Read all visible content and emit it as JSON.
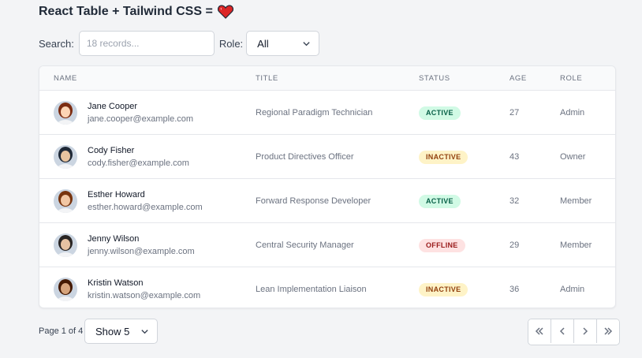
{
  "header": {
    "title": "React Table + Tailwind CSS =",
    "heart_icon": "heart-icon"
  },
  "filters": {
    "search_label": "Search:",
    "search_placeholder": "18 records...",
    "role_label": "Role:",
    "role_value": "All"
  },
  "table": {
    "columns": [
      "NAME",
      "TITLE",
      "STATUS",
      "AGE",
      "ROLE"
    ],
    "rows": [
      {
        "name": "Jane Cooper",
        "email": "jane.cooper@example.com",
        "title": "Regional Paradigm Technician",
        "status": "ACTIVE",
        "age": "27",
        "role": "Admin"
      },
      {
        "name": "Cody Fisher",
        "email": "cody.fisher@example.com",
        "title": "Product Directives Officer",
        "status": "INACTIVE",
        "age": "43",
        "role": "Owner"
      },
      {
        "name": "Esther Howard",
        "email": "esther.howard@example.com",
        "title": "Forward Response Developer",
        "status": "ACTIVE",
        "age": "32",
        "role": "Member"
      },
      {
        "name": "Jenny Wilson",
        "email": "jenny.wilson@example.com",
        "title": "Central Security Manager",
        "status": "OFFLINE",
        "age": "29",
        "role": "Member"
      },
      {
        "name": "Kristin Watson",
        "email": "kristin.watson@example.com",
        "title": "Lean Implementation Liaison",
        "status": "INACTIVE",
        "age": "36",
        "role": "Admin"
      }
    ]
  },
  "status_colors": {
    "ACTIVE": {
      "bg": "#d1fae5",
      "fg": "#065f46"
    },
    "INACTIVE": {
      "bg": "#fef3c7",
      "fg": "#92400e"
    },
    "OFFLINE": {
      "bg": "#fee2e2",
      "fg": "#991b1b"
    }
  },
  "pagination": {
    "page_text": "Page 1 of 4",
    "page_size_value": "Show 5",
    "buttons": [
      "first-page",
      "previous-page",
      "next-page",
      "last-page"
    ]
  }
}
